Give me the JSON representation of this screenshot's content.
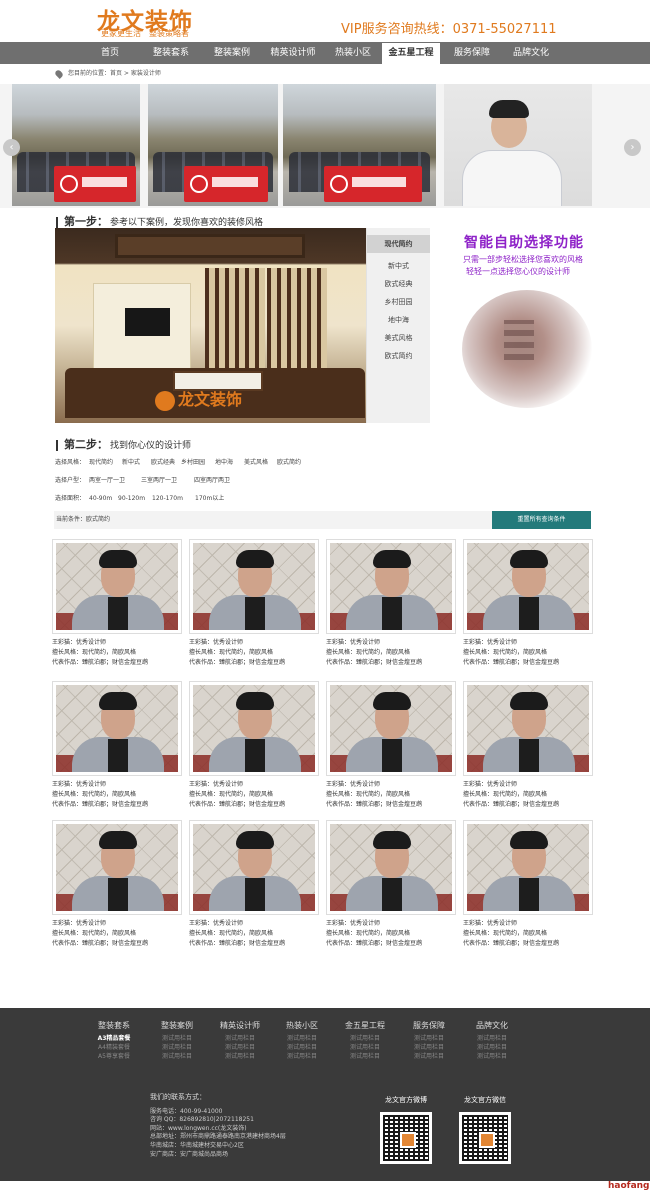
{
  "header": {
    "logo": "龙文装饰",
    "slogans": [
      "更家更生活",
      "整装策略者"
    ],
    "hotline": "VIP服务咨询热线：0371-55027111"
  },
  "nav": {
    "items": [
      "首页",
      "整装套系",
      "整装案例",
      "精英设计师",
      "热装小区",
      "金五星工程",
      "服务保障",
      "品牌文化"
    ],
    "active_index": 5
  },
  "breadcrumb": "您目前的位置：首页 > 家装设计师",
  "banner": {
    "arrow_left": "‹",
    "arrow_right": "›"
  },
  "step1": {
    "title": "第一步：",
    "text": "参考以下案例，发现你喜欢的装修风格",
    "watermark": "龙文装饰",
    "styles": [
      "现代简约",
      "新中式",
      "欧式经典",
      "乡村田园",
      "地中海",
      "美式风格",
      "欧式简约"
    ],
    "active_style": 0
  },
  "promo": {
    "title": "智能自助选择功能",
    "line1": "只需一部步轻松选择您喜欢的风格",
    "line2": "轻轻一点选择您心仪的设计师"
  },
  "step2": {
    "title": "第二步：",
    "text": "找到你心仪的设计师"
  },
  "filters": {
    "style_label": "选择风格：",
    "style_options": [
      "现代简约",
      "新中式",
      "欧式经典",
      "乡村田园",
      "地中海",
      "美式风格",
      "欧式简约"
    ],
    "layout_label": "选择户型：",
    "layout_options": [
      "两室一厅一卫",
      "三室两厅一卫",
      "四室两厅两卫"
    ],
    "area_label": "选择面积：",
    "area_options": [
      "40-90m",
      "90-120m",
      "120-170m",
      "170m以上"
    ],
    "condition": "当前条件：欧式简约",
    "reset_button": "重置所有查询条件"
  },
  "designers": [
    {
      "name": "王彩猫：优秀设计师",
      "style": "擅长风格：现代简约，简欧风格",
      "works": "代表作品：臻航泊郡；财信金煌豆鹉"
    },
    {
      "name": "王彩猫：优秀设计师",
      "style": "擅长风格：现代简约，简欧风格",
      "works": "代表作品：臻航泊郡；财信金煌豆鹉"
    },
    {
      "name": "王彩猫：优秀设计师",
      "style": "擅长风格：现代简约，简欧风格",
      "works": "代表作品：臻航泊郡；财信金煌豆鹉"
    },
    {
      "name": "王彩猫：优秀设计师",
      "style": "擅长风格：现代简约，简欧风格",
      "works": "代表作品：臻航泊郡；财信金煌豆鹉"
    },
    {
      "name": "王彩猫：优秀设计师",
      "style": "擅长风格：现代简约，简欧风格",
      "works": "代表作品：臻航泊郡；财信金煌豆鹉"
    },
    {
      "name": "王彩猫：优秀设计师",
      "style": "擅长风格：现代简约，简欧风格",
      "works": "代表作品：臻航泊郡；财信金煌豆鹉"
    },
    {
      "name": "王彩猫：优秀设计师",
      "style": "擅长风格：现代简约，简欧风格",
      "works": "代表作品：臻航泊郡；财信金煌豆鹉"
    },
    {
      "name": "王彩猫：优秀设计师",
      "style": "擅长风格：现代简约，简欧风格",
      "works": "代表作品：臻航泊郡；财信金煌豆鹉"
    },
    {
      "name": "王彩猫：优秀设计师",
      "style": "擅长风格：现代简约，简欧风格",
      "works": "代表作品：臻航泊郡；财信金煌豆鹉"
    },
    {
      "name": "王彩猫：优秀设计师",
      "style": "擅长风格：现代简约，简欧风格",
      "works": "代表作品：臻航泊郡；财信金煌豆鹉"
    },
    {
      "name": "王彩猫：优秀设计师",
      "style": "擅长风格：现代简约，简欧风格",
      "works": "代表作品：臻航泊郡；财信金煌豆鹉"
    },
    {
      "name": "王彩猫：优秀设计师",
      "style": "擅长风格：现代简约，简欧风格",
      "works": "代表作品：臻航泊郡；财信金煌豆鹉"
    }
  ],
  "footer": {
    "columns": [
      {
        "title": "整装套系",
        "items": [
          "A3精品套餐",
          "A4精装套餐",
          "A5尊享套餐"
        ]
      },
      {
        "title": "整装案例",
        "items": [
          "测试用栏目",
          "测试用栏目",
          "测试用栏目"
        ]
      },
      {
        "title": "精英设计师",
        "items": [
          "测试用栏目",
          "测试用栏目",
          "测试用栏目"
        ]
      },
      {
        "title": "热装小区",
        "items": [
          "测试用栏目",
          "测试用栏目",
          "测试用栏目"
        ]
      },
      {
        "title": "金五星工程",
        "items": [
          "测试用栏目",
          "测试用栏目",
          "测试用栏目"
        ]
      },
      {
        "title": "服务保障",
        "items": [
          "测试用栏目",
          "测试用栏目",
          "测试用栏目"
        ]
      },
      {
        "title": "品牌文化",
        "items": [
          "测试用栏目",
          "测试用栏目",
          "测试用栏目"
        ]
      }
    ],
    "contact_title": "我们的联系方式：",
    "contact_lines": [
      "服务电话：400-99-41000",
      "咨询 QQ：826892810|2072118251",
      "网站：www.longwen.cc(龙文装饰)",
      "总部地址：郑州市商鼎路通泰路南京港建材商场4层",
      "华南城店：华南城建材交易中心2区",
      "安广商店：安广商城尚品商场"
    ],
    "weibo_title": "龙文官方微博",
    "wechat_title": "龙文官方微信"
  },
  "watermark": "haofang"
}
